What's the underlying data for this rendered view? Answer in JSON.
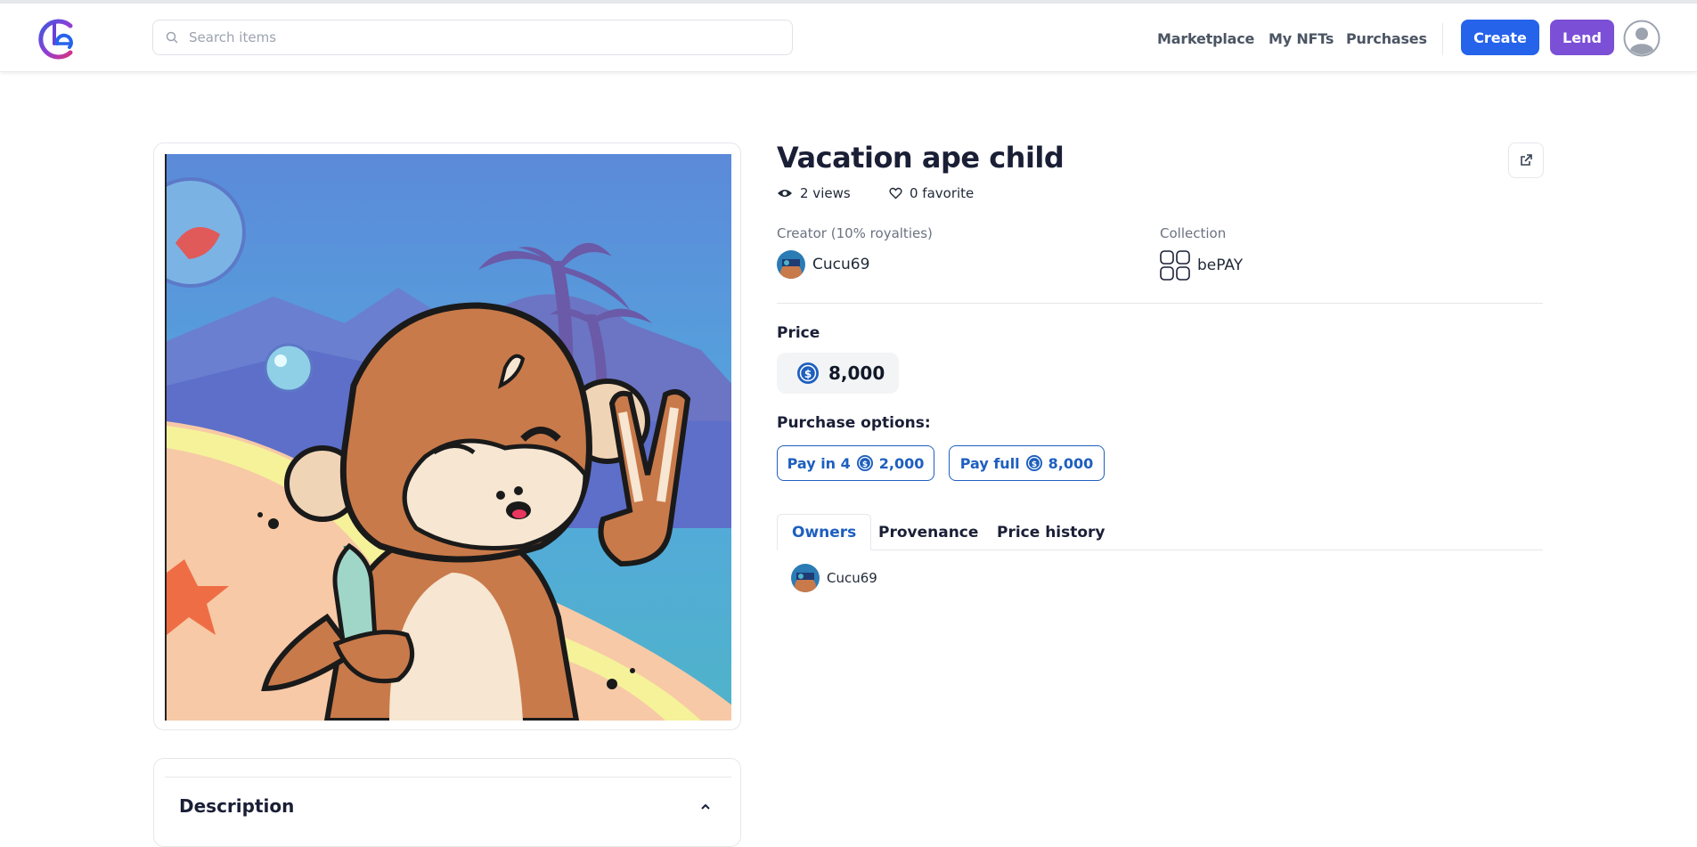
{
  "header": {
    "search_placeholder": "Search items",
    "nav": [
      "Marketplace",
      "My NFTs",
      "Purchases"
    ],
    "create_label": "Create",
    "lend_label": "Lend"
  },
  "item": {
    "title": "Vacation ape child",
    "views": "2 views",
    "favorites": "0 favorite",
    "creator_label": "Creator (10% royalties)",
    "creator_name": "Cucu69",
    "collection_label": "Collection",
    "collection_name": "bePAY",
    "price_label": "Price",
    "price": "8,000",
    "purchase_options_label": "Purchase options:",
    "options": [
      {
        "label": "Pay in 4",
        "amount": "2,000"
      },
      {
        "label": "Pay full",
        "amount": "8,000"
      }
    ],
    "tabs": [
      "Owners",
      "Provenance",
      "Price history"
    ],
    "owners": [
      "Cucu69"
    ],
    "description_title": "Description"
  },
  "colors": {
    "create": "#2563eb",
    "lend": "#7b4fd6",
    "accent": "#1e5fbf"
  }
}
